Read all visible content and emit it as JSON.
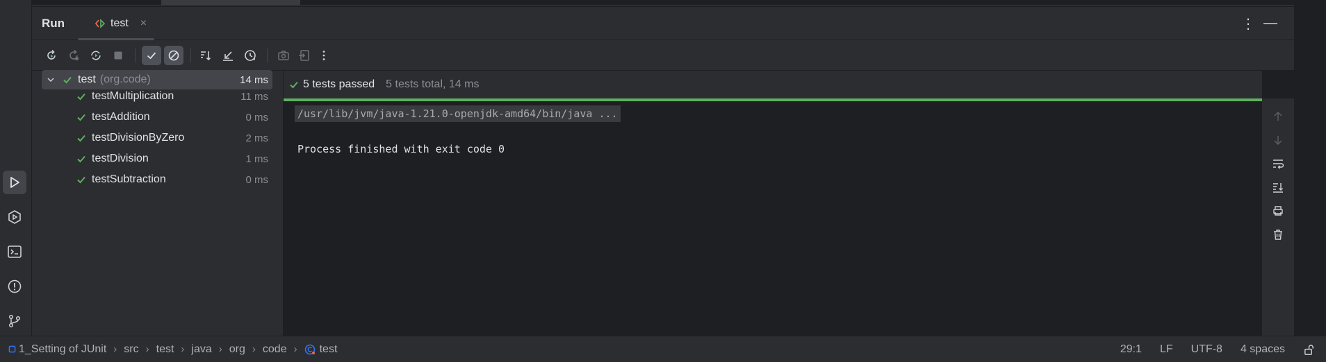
{
  "tool_window": {
    "title": "Run",
    "tab_label": "test",
    "tab_close": "×",
    "more": "⋮",
    "minimize": "—"
  },
  "toolbar": {
    "buttons": [
      "rerun-icon",
      "rerun-failed-icon",
      "rerun-auto-icon",
      "stop-icon",
      "show-passed-icon",
      "show-ignored-icon",
      "sort-icon",
      "collapse-icon",
      "history-icon",
      "screenshot-icon",
      "export-icon",
      "more-icon"
    ]
  },
  "tree": {
    "root": {
      "name": "test",
      "package": "(org.code)",
      "duration": "14 ms"
    },
    "items": [
      {
        "name": "testMultiplication",
        "duration": "11 ms"
      },
      {
        "name": "testAddition",
        "duration": "0 ms"
      },
      {
        "name": "testDivisionByZero",
        "duration": "2 ms"
      },
      {
        "name": "testDivision",
        "duration": "1 ms"
      },
      {
        "name": "testSubtraction",
        "duration": "0 ms"
      }
    ]
  },
  "status": {
    "passed": "5 tests passed",
    "total": "5 tests total, 14 ms",
    "progress": 1.0
  },
  "console": {
    "command": "/usr/lib/jvm/java-1.21.0-openjdk-amd64/bin/java ...",
    "exit": "Process finished with exit code 0"
  },
  "footer": {
    "crumbs": [
      "1_Setting of JUnit",
      "src",
      "test",
      "java",
      "org",
      "code",
      "test"
    ],
    "position": "29:1",
    "line_sep": "LF",
    "encoding": "UTF-8",
    "indent": "4 spaces"
  },
  "colors": {
    "accent_green": "#5fb05f",
    "background": "#1e1f22",
    "panel": "#2b2d30"
  }
}
